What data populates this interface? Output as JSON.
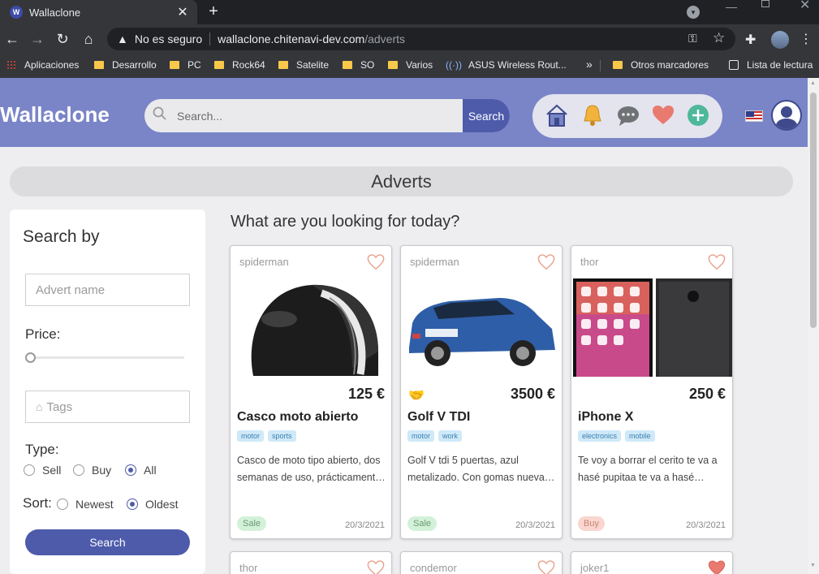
{
  "browser": {
    "tab_title": "Wallaclone",
    "tab_favicon": "W",
    "not_secure": "No es seguro",
    "url_host": "wallaclone.chitenavi-dev.com",
    "url_path": "/adverts",
    "bookmarks": [
      "Aplicaciones",
      "Desarrollo",
      "PC",
      "Rock64",
      "Satelite",
      "SO",
      "Varios",
      "ASUS Wireless Rout...",
      "Otros marcadores",
      "Lista de lectura"
    ]
  },
  "header": {
    "brand": "Wallaclone",
    "search_placeholder": "Search...",
    "search_button": "Search",
    "colors": {
      "header_bg": "#7a85c8",
      "accent": "#4e5bab"
    }
  },
  "page": {
    "title_bar": "Adverts",
    "content_title": "What are you looking for today?"
  },
  "sidebar": {
    "title": "Search by",
    "advert_name_placeholder": "Advert name",
    "price_label": "Price:",
    "price_slider_fraction": 0,
    "tags_placeholder": "Tags",
    "type_label": "Type:",
    "type_options": [
      "Sell",
      "Buy",
      "All"
    ],
    "type_selected": "All",
    "sort_label": "Sort:",
    "sort_options": [
      "Newest",
      "Oldest"
    ],
    "sort_selected": "Oldest",
    "search_button": "Search"
  },
  "adverts": [
    {
      "user": "spiderman",
      "price": "125 €",
      "name": "Casco moto abierto",
      "tags": [
        "motor",
        "sports"
      ],
      "description": "Casco de moto tipo abierto, dos semanas de uso, prácticament…",
      "type": "Sale",
      "date": "20/3/2021",
      "favorite": false,
      "deal_icon": false
    },
    {
      "user": "spiderman",
      "price": "3500 €",
      "name": "Golf V TDI",
      "tags": [
        "motor",
        "work"
      ],
      "description": "Golf V tdi 5 puertas, azul metalizado. Con gomas nueva…",
      "type": "Sale",
      "date": "20/3/2021",
      "favorite": false,
      "deal_icon": true
    },
    {
      "user": "thor",
      "price": "250 €",
      "name": "iPhone X",
      "tags": [
        "electronics",
        "mobile"
      ],
      "description": "Te voy a borrar el cerito te va a hasé pupitaa te va a hasé…",
      "type": "Buy",
      "date": "20/3/2021",
      "favorite": false,
      "deal_icon": false
    },
    {
      "user": "thor",
      "favorite": false
    },
    {
      "user": "condemor",
      "favorite": false
    },
    {
      "user": "joker1",
      "favorite": true
    }
  ]
}
